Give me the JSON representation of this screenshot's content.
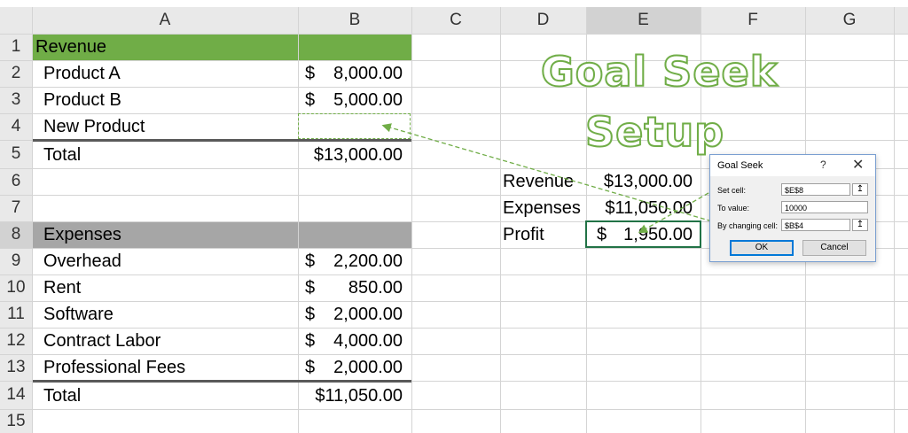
{
  "columns": [
    "A",
    "B",
    "C",
    "D",
    "E",
    "F",
    "G"
  ],
  "rows": [
    "1",
    "2",
    "3",
    "4",
    "5",
    "6",
    "7",
    "8",
    "9",
    "10",
    "11",
    "12",
    "13",
    "14",
    "15"
  ],
  "revenue_header": "Revenue",
  "revenue_items": [
    {
      "label": "Product A",
      "symbol": "$",
      "value": "8,000.00"
    },
    {
      "label": "Product B",
      "symbol": "$",
      "value": "5,000.00"
    },
    {
      "label": "New Product",
      "symbol": "",
      "value": ""
    }
  ],
  "revenue_total": {
    "label": "Total",
    "value": "$13,000.00"
  },
  "expenses_header": "Expenses",
  "expense_items": [
    {
      "label": "Overhead",
      "symbol": "$",
      "value": "2,200.00"
    },
    {
      "label": "Rent",
      "symbol": "$",
      "value": "850.00"
    },
    {
      "label": "Software",
      "symbol": "$",
      "value": "2,000.00"
    },
    {
      "label": "Contract Labor",
      "symbol": "$",
      "value": "4,000.00"
    },
    {
      "label": "Professional Fees",
      "symbol": "$",
      "value": "2,000.00"
    }
  ],
  "expenses_total": {
    "label": "Total",
    "value": "$11,050.00"
  },
  "summary": [
    {
      "label": "Revenue",
      "value": "$13,000.00"
    },
    {
      "label": "Expenses",
      "value": "$11,050.00"
    },
    {
      "label": "Profit",
      "symbol": "$",
      "value": "1,950.00"
    }
  ],
  "title_line1": "Goal Seek",
  "title_line2": "Setup",
  "dialog": {
    "title": "Goal Seek",
    "help": "?",
    "close": "✕",
    "set_cell_label": "Set cell:",
    "set_cell_value": "$E$8",
    "to_value_label": "To value:",
    "to_value_value": "10000",
    "changing_cell_label": "By changing cell:",
    "changing_cell_value": "$B$4",
    "ref_glyph": "↥",
    "ok_label": "OK",
    "cancel_label": "Cancel"
  },
  "colors": {
    "revenue_fill": "#70ad47",
    "expenses_fill": "#a6a6a6",
    "arrow_color": "#70ad47",
    "grid": "#d4d4d4"
  }
}
